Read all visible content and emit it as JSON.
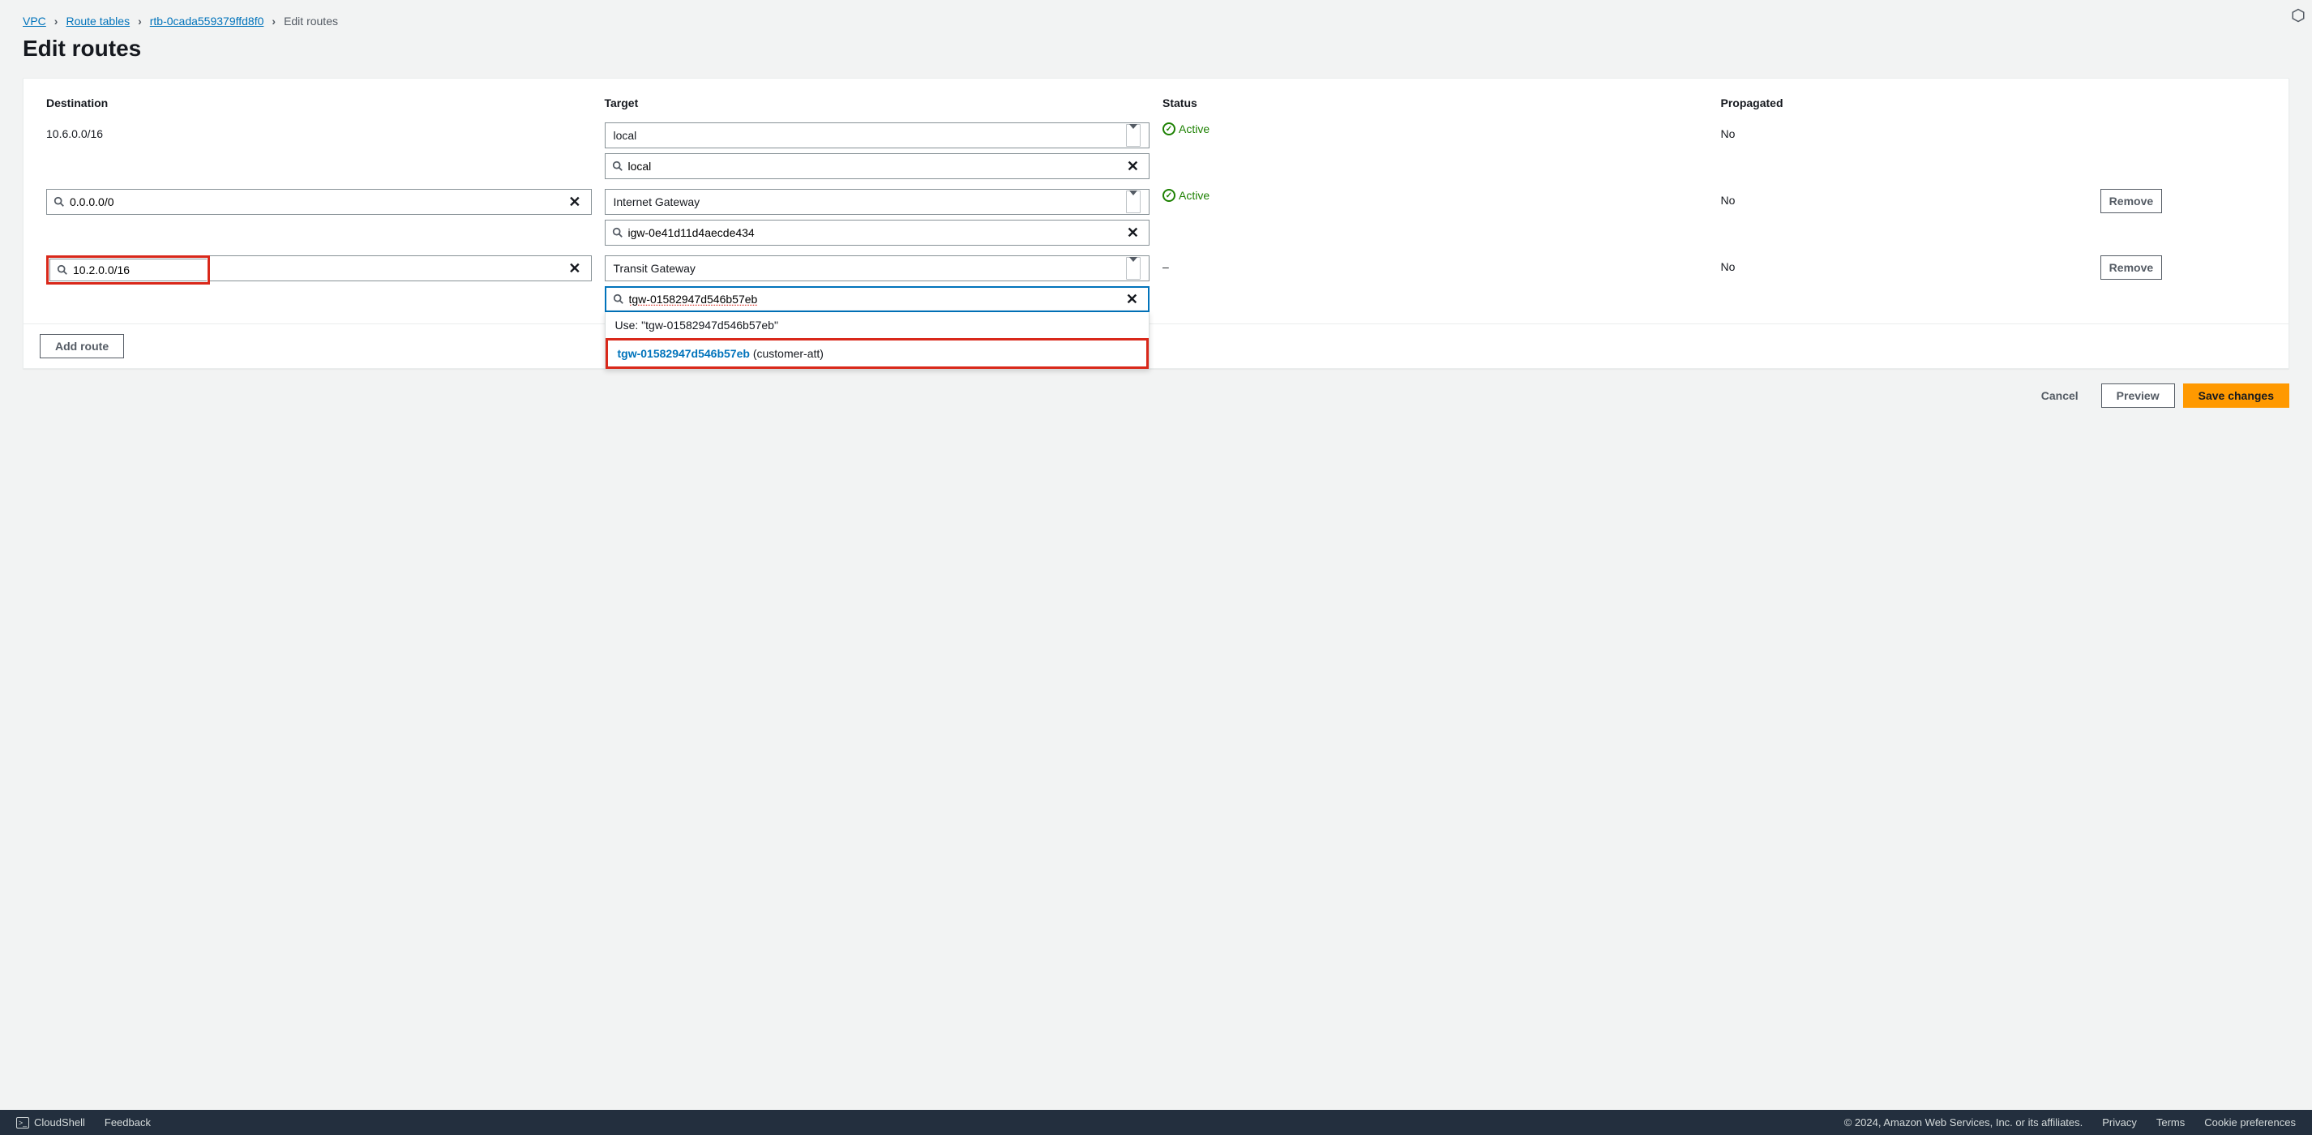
{
  "breadcrumb": {
    "items": [
      "VPC",
      "Route tables",
      "rtb-0cada559379ffd8f0"
    ],
    "current": "Edit routes"
  },
  "page": {
    "title": "Edit routes"
  },
  "headers": {
    "destination": "Destination",
    "target": "Target",
    "status": "Status",
    "propagated": "Propagated"
  },
  "routes": [
    {
      "destination": "10.6.0.0/16",
      "destination_editable": false,
      "target_type": "local",
      "target_filter_value": "local",
      "status": "Active",
      "propagated": "No",
      "removable": false
    },
    {
      "destination": "0.0.0.0/0",
      "destination_editable": true,
      "target_type": "Internet Gateway",
      "target_filter_value": "igw-0e41d11d4aecde434",
      "status": "Active",
      "propagated": "No",
      "removable": true
    },
    {
      "destination": "10.2.0.0/16",
      "destination_editable": true,
      "destination_highlighted": true,
      "target_type": "Transit Gateway",
      "target_filter_value": "tgw-01582947d546b57eb",
      "target_filter_focused": true,
      "status": "–",
      "status_is_active": false,
      "propagated": "No",
      "removable": true,
      "dropdown_open": true
    }
  ],
  "dropdown": {
    "use_label": "Use: \"tgw-01582947d546b57eb\"",
    "suggestion_id": "tgw-01582947d546b57eb",
    "suggestion_name": " (customer-att)"
  },
  "buttons": {
    "add_route": "Add route",
    "remove": "Remove",
    "cancel": "Cancel",
    "preview": "Preview",
    "save": "Save changes"
  },
  "footer": {
    "cloudshell": "CloudShell",
    "feedback": "Feedback",
    "copyright": "© 2024, Amazon Web Services, Inc. or its affiliates.",
    "privacy": "Privacy",
    "terms": "Terms",
    "cookie": "Cookie preferences"
  }
}
